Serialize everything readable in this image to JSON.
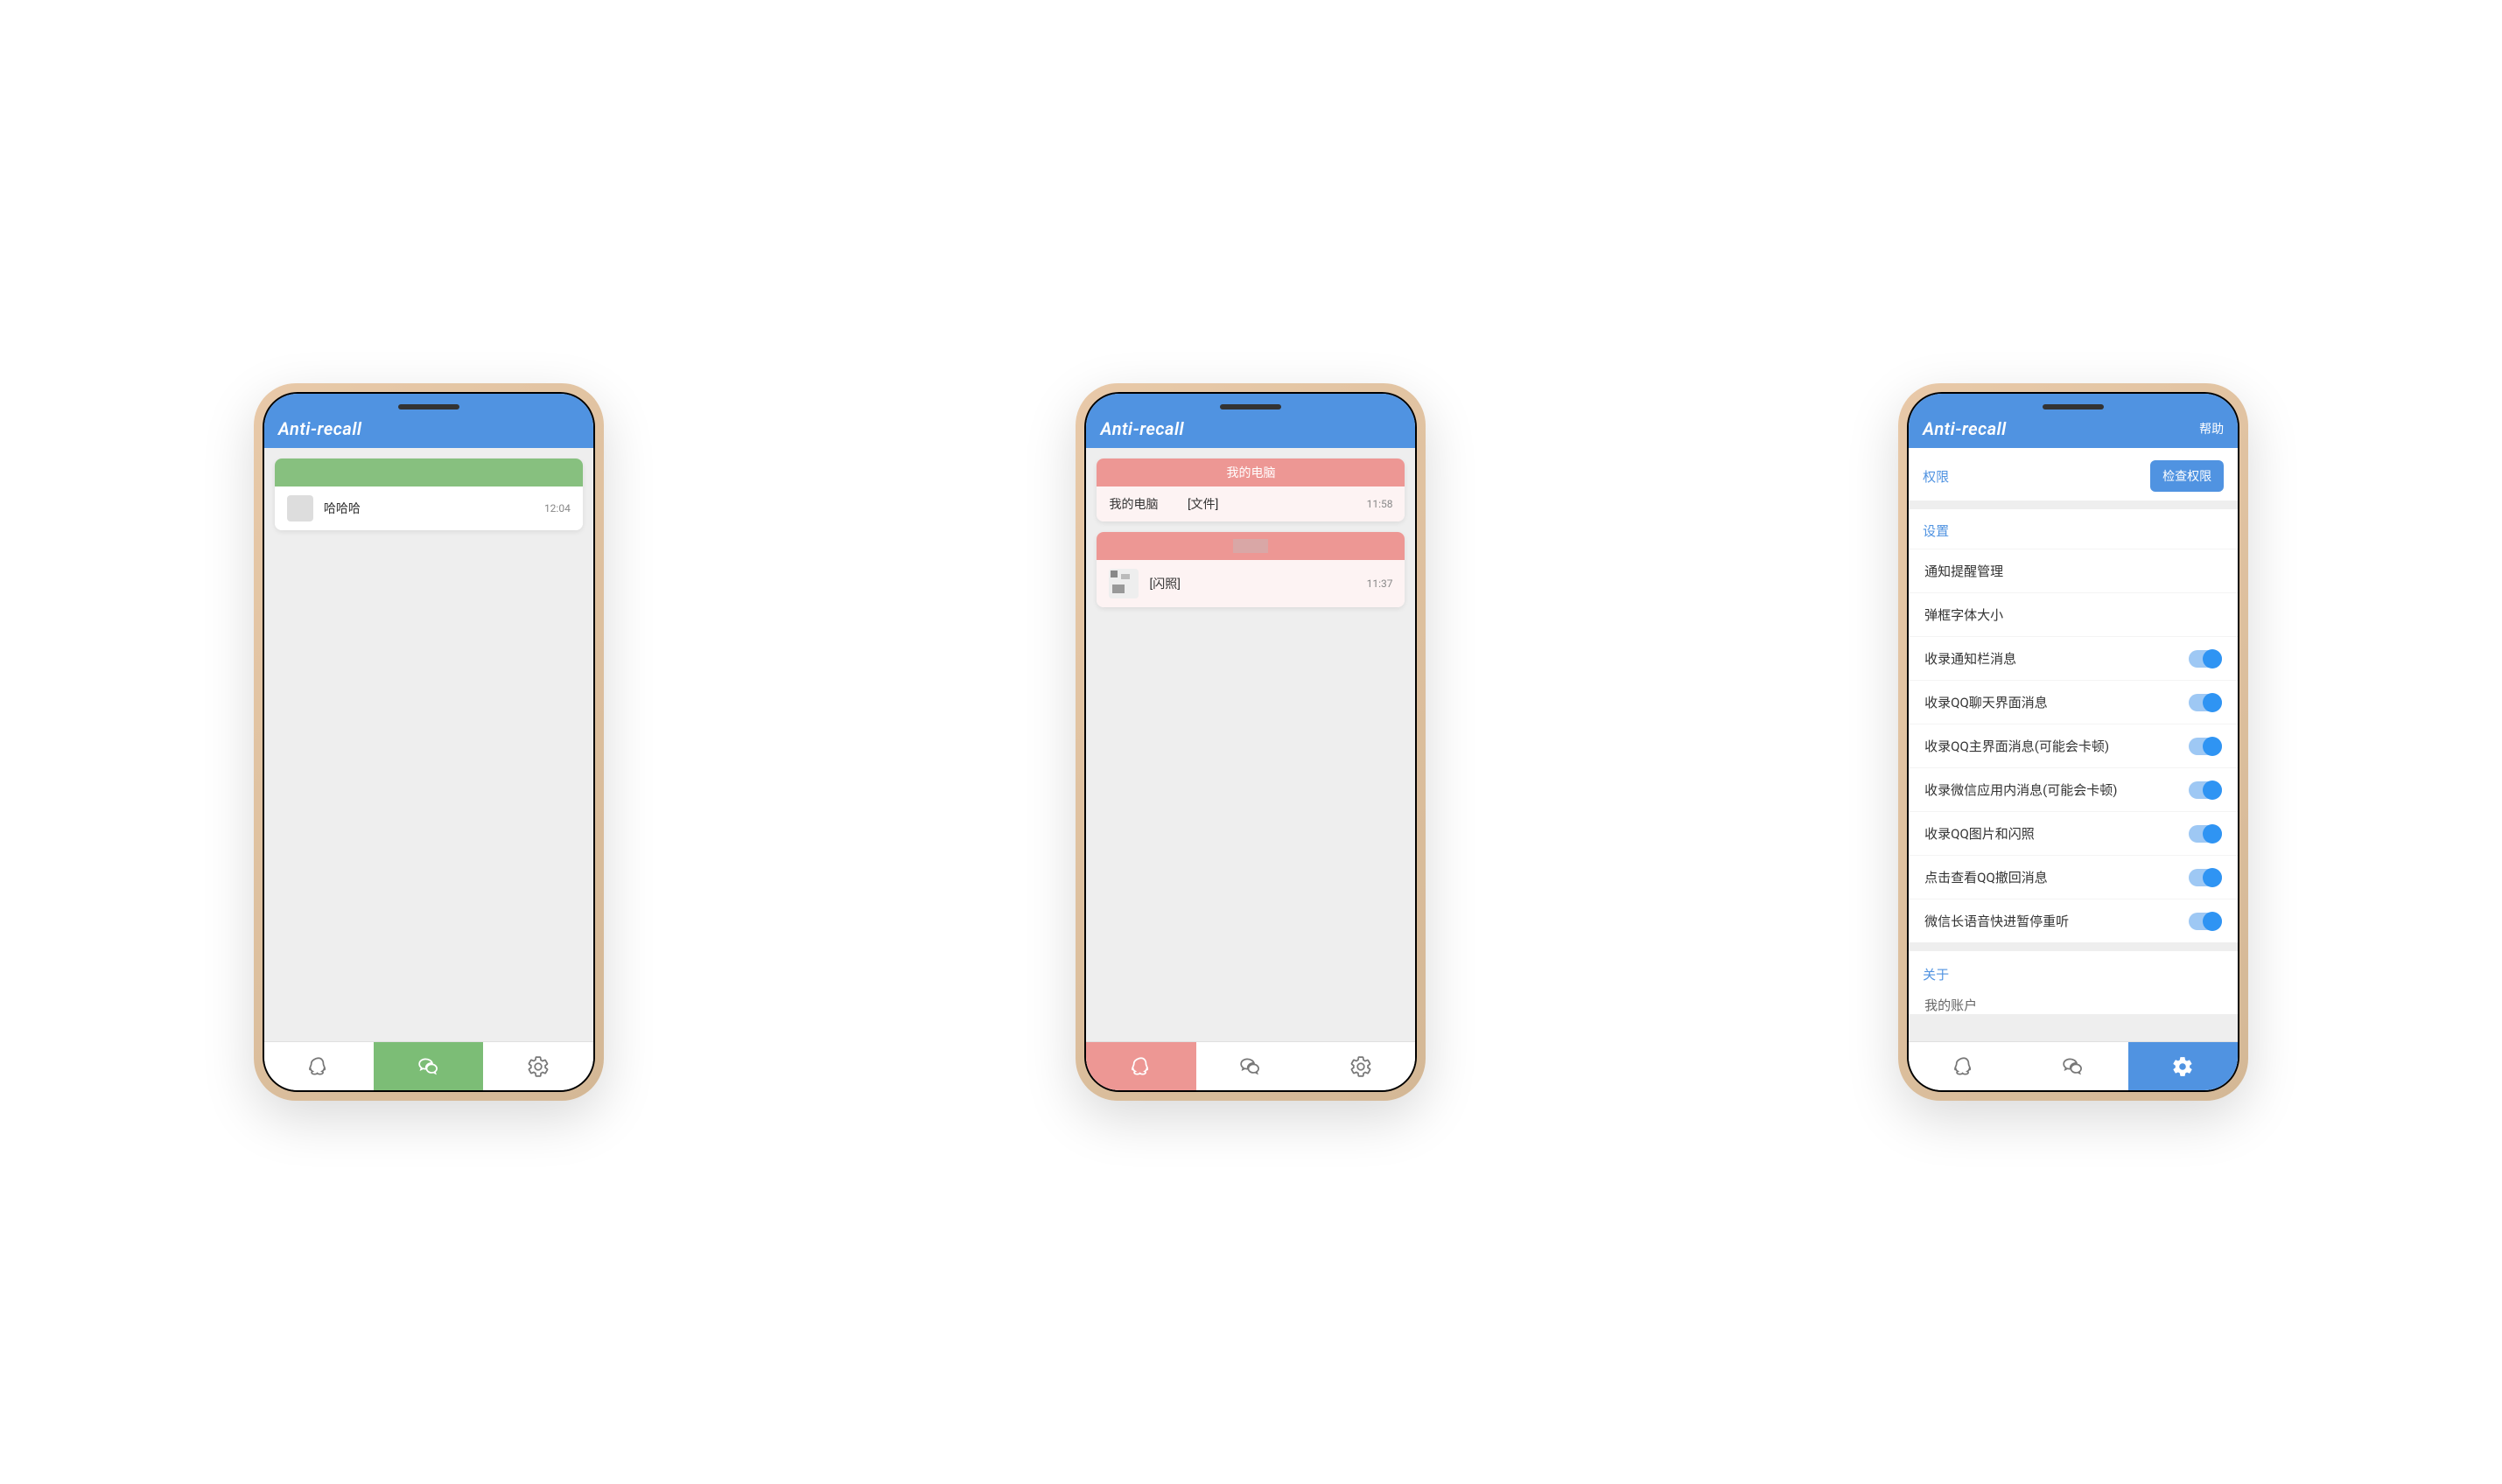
{
  "app_title": "Anti-recall",
  "help_label": "帮助",
  "phone1": {
    "card_title": "",
    "rows": [
      {
        "sender": "",
        "text": "哈哈哈",
        "time": "12:04"
      }
    ]
  },
  "phone2": {
    "cards": [
      {
        "title": "我的电脑",
        "sender": "我的电脑",
        "text": "[文件]",
        "time": "11:58"
      },
      {
        "title": "",
        "sender": "",
        "text": "[闪照]",
        "time": "11:37"
      }
    ]
  },
  "phone3": {
    "permissions_label": "权限",
    "check_permissions": "检查权限",
    "settings_label": "设置",
    "rows": [
      {
        "label": "通知提醒管理",
        "toggle": false
      },
      {
        "label": "弹框字体大小",
        "toggle": false
      },
      {
        "label": "收录通知栏消息",
        "toggle": true
      },
      {
        "label": "收录QQ聊天界面消息",
        "toggle": true
      },
      {
        "label": "收录QQ主界面消息(可能会卡顿)",
        "toggle": true
      },
      {
        "label": "收录微信应用内消息(可能会卡顿)",
        "toggle": true
      },
      {
        "label": "收录QQ图片和闪照",
        "toggle": true
      },
      {
        "label": "点击查看QQ撤回消息",
        "toggle": true
      },
      {
        "label": "微信长语音快进暂停重听",
        "toggle": true
      }
    ],
    "about_label": "关于",
    "about_row": "我的账户"
  },
  "nav": {
    "qq": "qq-icon",
    "wechat": "wechat-icon",
    "settings": "settings-icon"
  }
}
